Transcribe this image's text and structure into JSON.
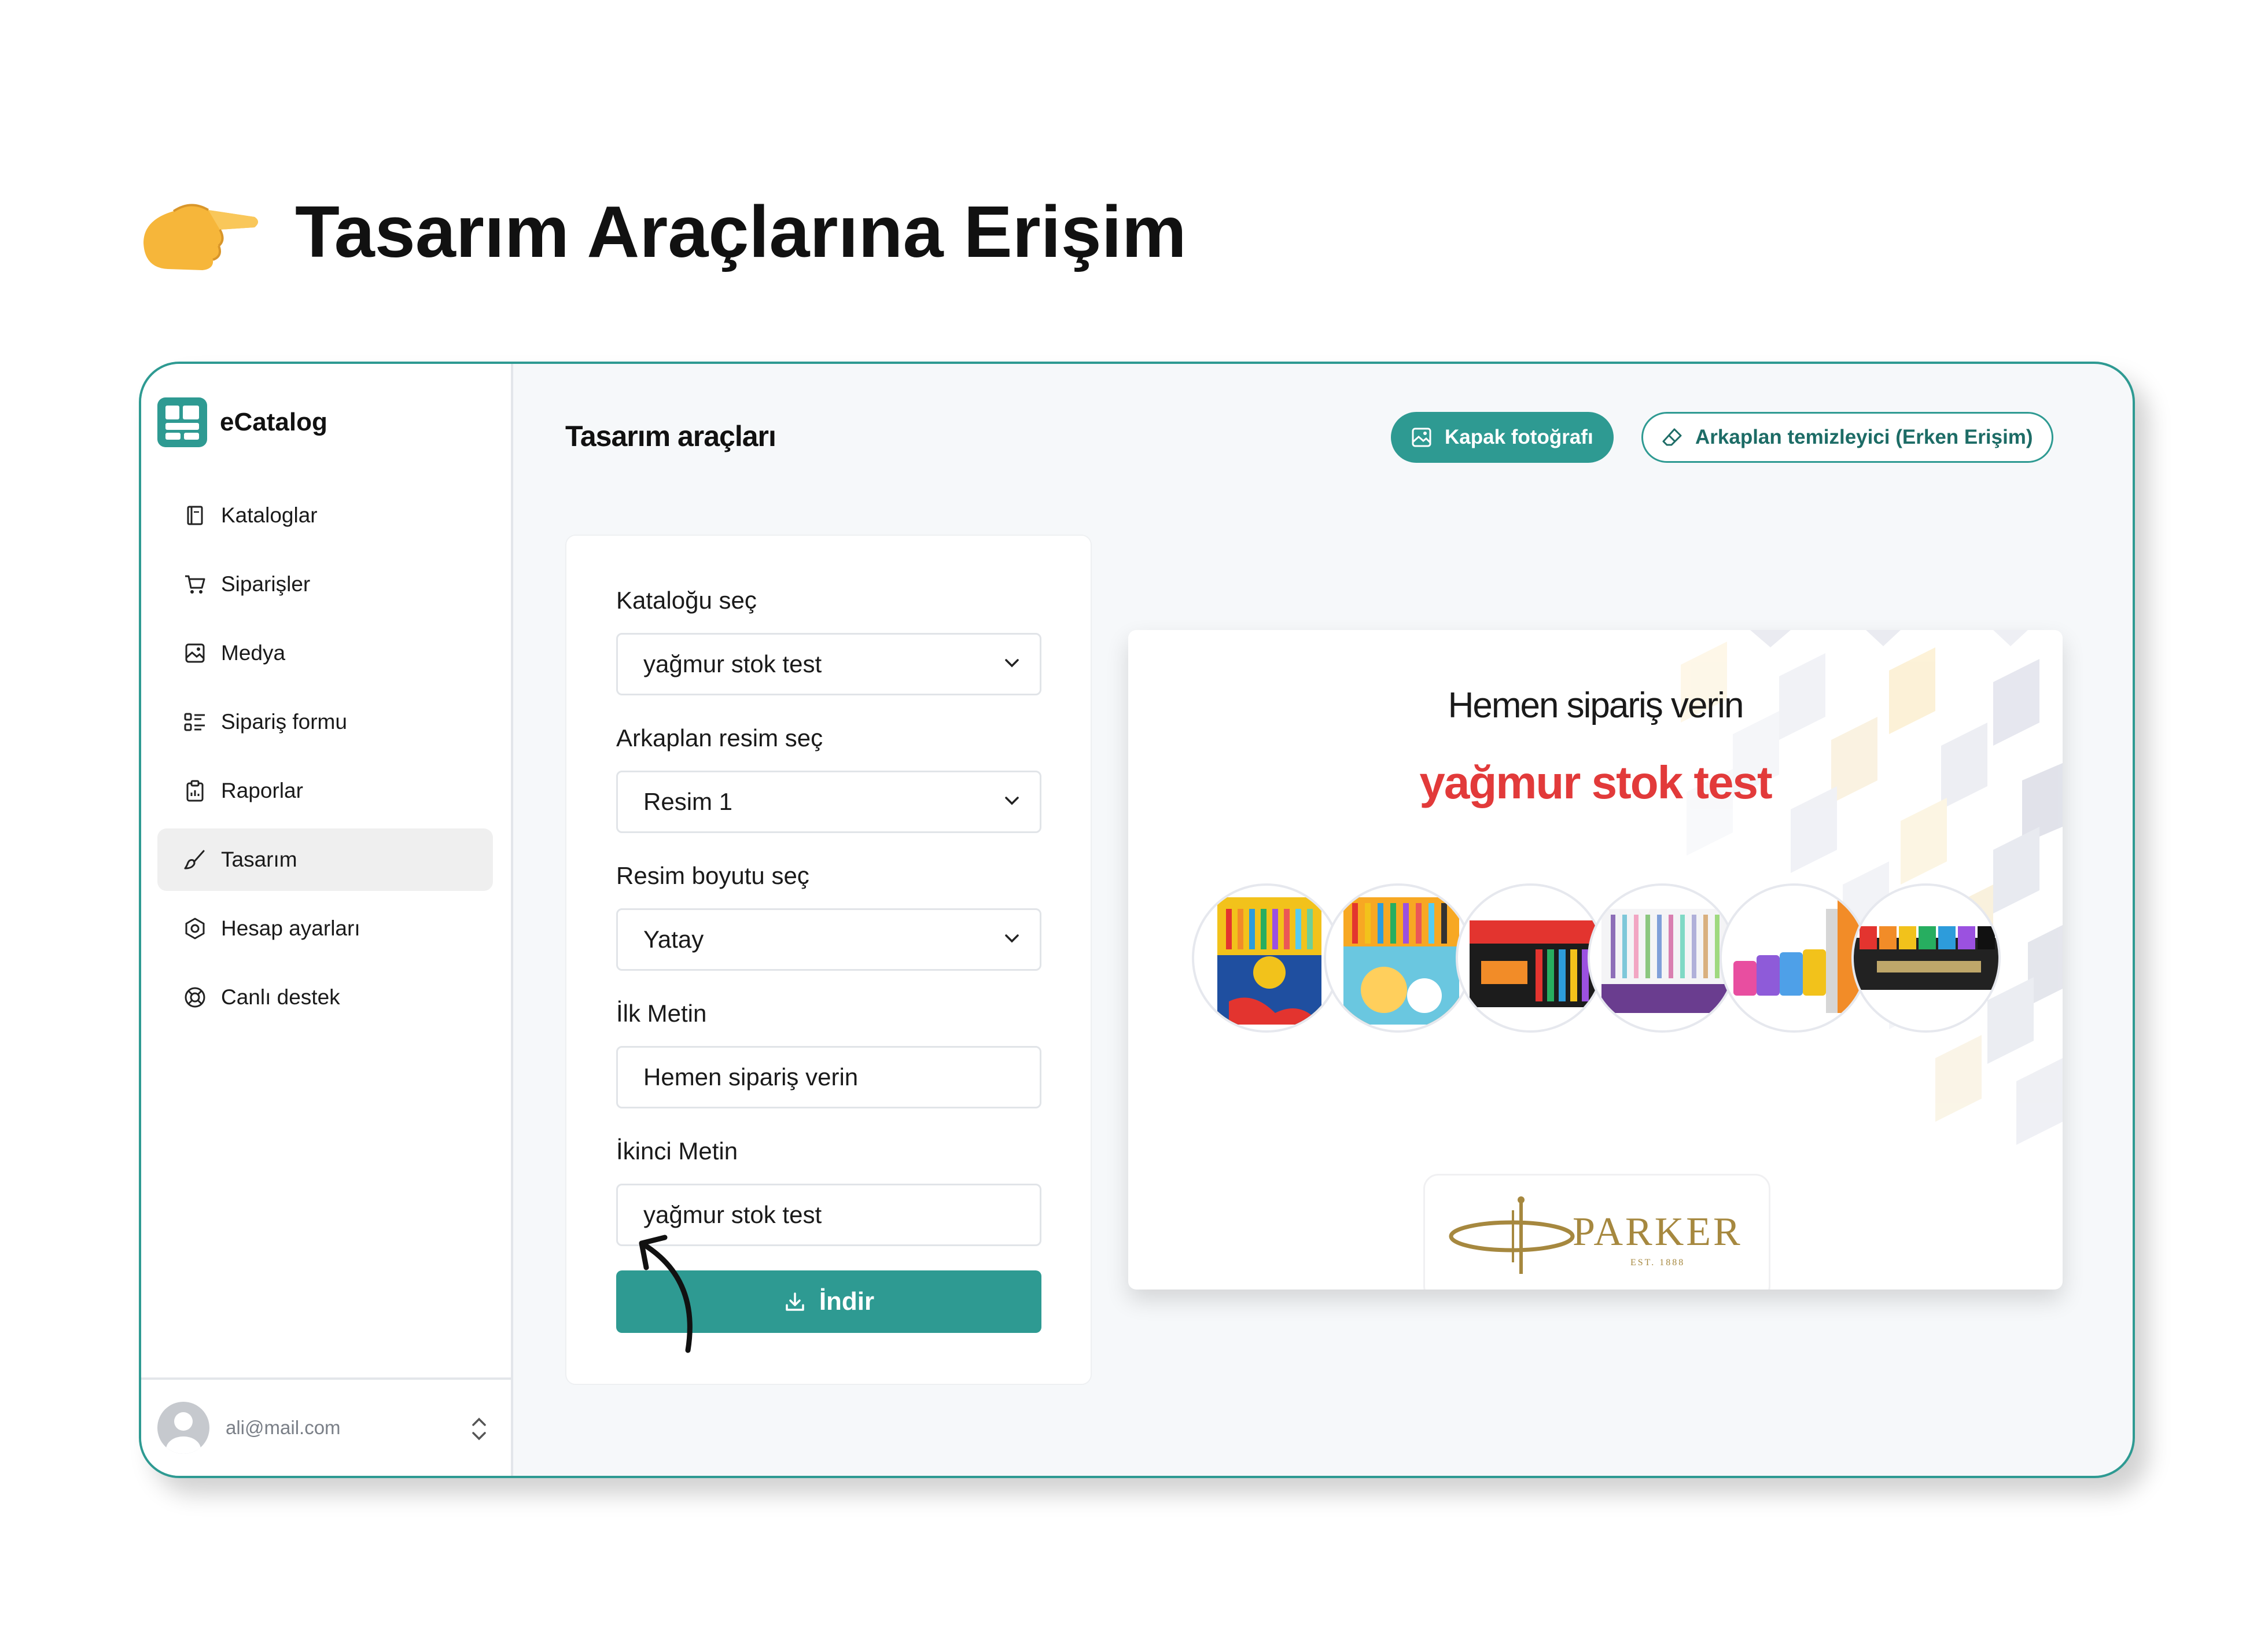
{
  "heading": {
    "title": "Tasarım Araçlarına Erişim",
    "icon": "pointing-hand-icon"
  },
  "brand": {
    "name": "eCatalog",
    "color": "#2e9a92"
  },
  "sidebar": {
    "items": [
      {
        "label": "Kataloglar",
        "icon": "book-icon"
      },
      {
        "label": "Siparişler",
        "icon": "cart-icon"
      },
      {
        "label": "Medya",
        "icon": "image-icon"
      },
      {
        "label": "Sipariş formu",
        "icon": "form-list-icon"
      },
      {
        "label": "Raporlar",
        "icon": "clipboard-icon"
      },
      {
        "label": "Tasarım",
        "icon": "brush-icon",
        "active": true
      },
      {
        "label": "Hesap ayarları",
        "icon": "settings-hexagon-icon"
      },
      {
        "label": "Canlı destek",
        "icon": "lifebuoy-icon"
      }
    ],
    "user": {
      "email": "ali@mail.com"
    }
  },
  "main": {
    "title": "Tasarım araçları",
    "actions": {
      "cover_photo": "Kapak fotoğrafı",
      "bg_remover": "Arkaplan temizleyici (Erken Erişim)"
    }
  },
  "form": {
    "catalog_label": "Kataloğu seç",
    "catalog_value": "yağmur stok test",
    "bg_label": "Arkaplan resim seç",
    "bg_value": "Resim 1",
    "size_label": "Resim boyutu seç",
    "size_value": "Yatay",
    "first_text_label": "İlk Metin",
    "first_text_value": "Hemen sipariş verin",
    "second_text_label": "İkinci Metin",
    "second_text_value": "yağmur stok test",
    "download_label": "İndir"
  },
  "preview": {
    "line1": "Hemen sipariş verin",
    "line2": "yağmur stok test",
    "line2_color": "#e23a3a",
    "brand_logo_text": "PARKER",
    "brand_logo_sub": "EST. 1888"
  }
}
